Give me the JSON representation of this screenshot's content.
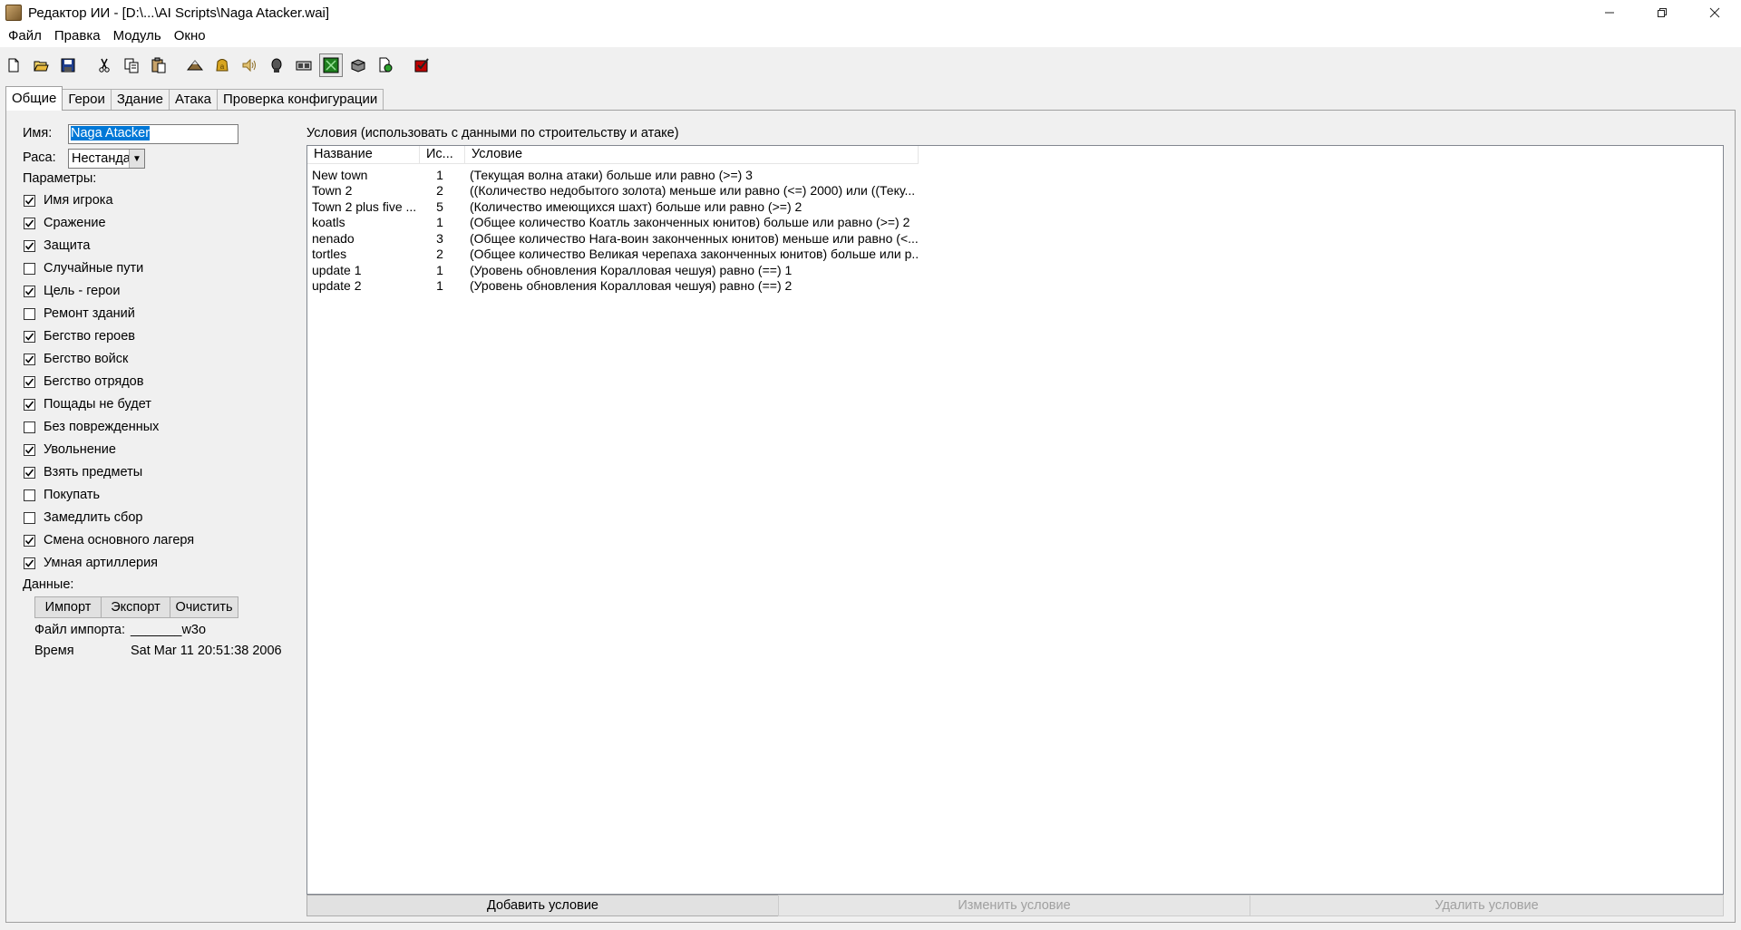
{
  "window": {
    "title": "Редактор ИИ - [D:\\...\\AI Scripts\\Naga Atacker.wai]"
  },
  "menu": [
    "Файл",
    "Правка",
    "Модуль",
    "Окно"
  ],
  "toolbar": {
    "icons": [
      "new-icon",
      "open-icon",
      "save-icon",
      "cut-icon",
      "copy-icon",
      "paste-icon",
      "terrain-icon",
      "gold-icon",
      "sound-icon",
      "unit-icon",
      "model-icon",
      "map-icon",
      "book-icon",
      "export-icon",
      "test-icon"
    ],
    "pressed": "map-icon"
  },
  "tabs": [
    "Общие",
    "Герои",
    "Здание",
    "Атака",
    "Проверка конфигурации"
  ],
  "active_tab": "Общие",
  "general": {
    "name_label": "Имя:",
    "name_value": "Naga Atacker",
    "race_label": "Раса:",
    "race_value": "Нестандартная",
    "params_label": "Параметры:",
    "params": [
      {
        "label": "Имя игрока",
        "checked": true
      },
      {
        "label": "Сражение",
        "checked": true
      },
      {
        "label": "Защита",
        "checked": true
      },
      {
        "label": "Случайные пути",
        "checked": false
      },
      {
        "label": "Цель - герои",
        "checked": true
      },
      {
        "label": "Ремонт зданий",
        "checked": false
      },
      {
        "label": "Бегство героев",
        "checked": true
      },
      {
        "label": "Бегство войск",
        "checked": true
      },
      {
        "label": "Бегство отрядов",
        "checked": true
      },
      {
        "label": "Пощады не будет",
        "checked": true
      },
      {
        "label": "Без поврежденных",
        "checked": false
      },
      {
        "label": "Увольнение",
        "checked": true
      },
      {
        "label": "Взять предметы",
        "checked": true
      },
      {
        "label": "Покупать",
        "checked": false
      },
      {
        "label": "Замедлить сбор",
        "checked": false
      },
      {
        "label": "Смена основного лагеря",
        "checked": true
      },
      {
        "label": "Умная артиллерия",
        "checked": true
      }
    ],
    "data_label": "Данные:",
    "import_button": "Импорт",
    "export_button": "Экспорт",
    "clear_button": "Очистить",
    "import_file_label": "Файл импорта:",
    "import_file_value": "_______w3o",
    "time_label": "Время",
    "time_value": "Sat Mar 11 20:51:38 2006"
  },
  "conditions": {
    "title": "Условия (использовать с данными по строительству и атаке)",
    "columns": [
      "Название",
      "Ис...",
      "Условие"
    ],
    "rows": [
      {
        "name": "New town",
        "num": "1",
        "cond": "(Текущая волна атаки) больше или равно (>=) 3"
      },
      {
        "name": "Town 2",
        "num": "2",
        "cond": "((Количество недобытого золота) меньше или равно (<=) 2000) или ((Теку..."
      },
      {
        "name": "Town 2 plus five ...",
        "num": "5",
        "cond": "(Количество имеющихся шахт) больше или равно (>=) 2"
      },
      {
        "name": "koatls",
        "num": "1",
        "cond": "(Общее количество Коатль законченных юнитов) больше или равно (>=) 2"
      },
      {
        "name": "nenado",
        "num": "3",
        "cond": "(Общее количество Нага-воин законченных юнитов) меньше или равно (<..."
      },
      {
        "name": "tortles",
        "num": "2",
        "cond": "(Общее количество Великая черепаха законченных юнитов) больше или р..."
      },
      {
        "name": "update 1",
        "num": "1",
        "cond": "(Уровень обновления Коралловая чешуя) равно (==) 1"
      },
      {
        "name": "update 2",
        "num": "1",
        "cond": "(Уровень обновления Коралловая чешуя) равно (==) 2"
      }
    ],
    "add_button": "Добавить условие",
    "edit_button": "Изменить условие",
    "delete_button": "Удалить условие"
  }
}
